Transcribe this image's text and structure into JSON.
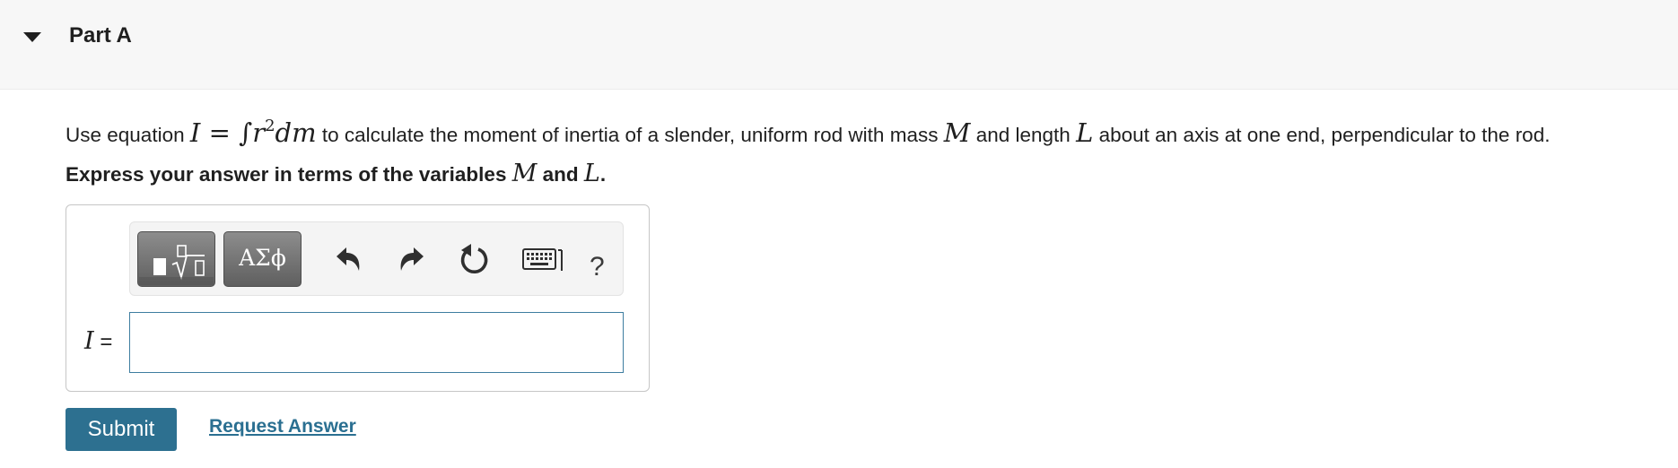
{
  "part": {
    "title": "Part A"
  },
  "question": {
    "prefix": "Use equation",
    "eq_var": "I",
    "eq_rest": "= ∫",
    "eq_r": "r",
    "eq_exp": "2",
    "eq_dm": "dm",
    "middle": "to calculate the moment of inertia of a slender, uniform rod with mass",
    "var_m": "M",
    "and_text": "and length",
    "var_l": "L",
    "suffix": "about an axis at one end, perpendicular to the rod."
  },
  "instruction": {
    "prefix": "Express your answer in terms of the variables",
    "var_m": "M",
    "and_text": "and",
    "var_l": "L",
    "period": "."
  },
  "toolbar": {
    "templates_icon": "templates-icon",
    "symbols_label": "ΑΣϕ",
    "undo_icon": "undo-icon",
    "redo_icon": "redo-icon",
    "reset_icon": "reset-icon",
    "keyboard_icon": "keyboard-icon",
    "help_label": "?"
  },
  "answer": {
    "var": "I",
    "equals": "=",
    "value": "",
    "placeholder": ""
  },
  "actions": {
    "submit_label": "Submit",
    "request_label": "Request Answer"
  },
  "colors": {
    "header_bg": "#f7f7f7",
    "submit_bg": "#2d7090",
    "link": "#2a6f91",
    "input_border": "#3e7da0"
  }
}
